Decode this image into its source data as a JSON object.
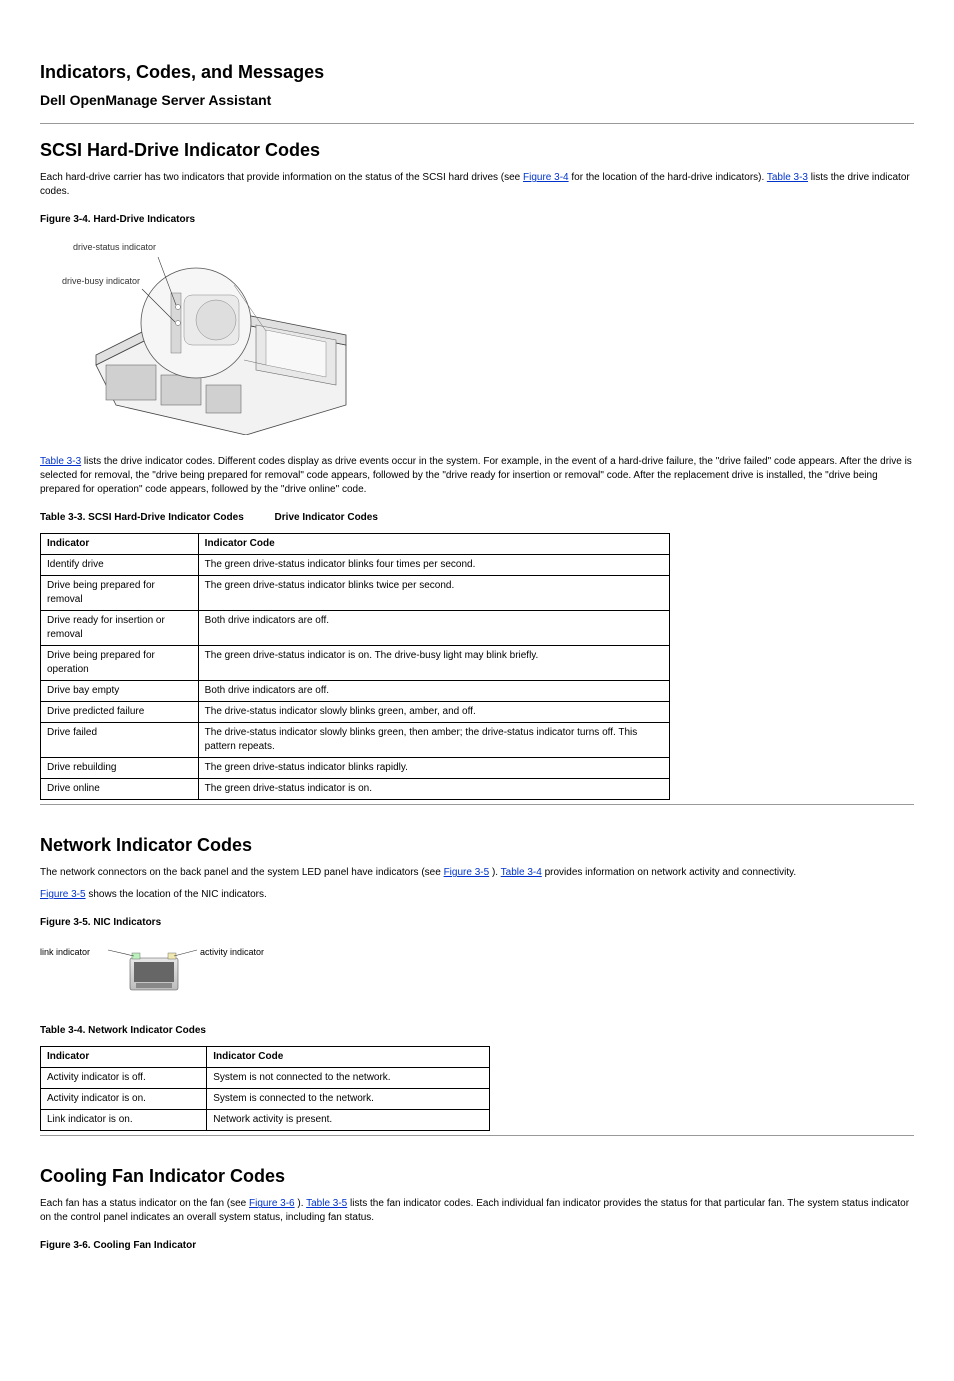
{
  "header": {
    "title": "Indicators, Codes, and Messages",
    "subtitle": "Dell OpenManage Server Assistant"
  },
  "section1": {
    "heading": "SCSI Hard-Drive Indicator Codes",
    "p1a": "Each hard-drive carrier has two indicators that provide information on the status of the SCSI hard drives (see ",
    "fig_link": "Figure 3-4",
    "p1b": " for the location of the hard-drive indicators). ",
    "tbl_link": "Table 3-3",
    "p1c": " lists the drive indicator codes.",
    "fig_caption": "Figure 3-4. Hard-Drive Indicators",
    "callout_status": "drive-status indicator",
    "callout_busy": "drive-busy indicator",
    "p2a": "Table 3-3",
    "p2b": " lists the drive indicator codes. Different codes display as drive events occur in the system. For example, in the event of a hard-drive failure, the \"drive failed\" code appears. After the drive is selected for removal, the \"drive being prepared for removal\" code appears, followed by the \"drive ready for insertion or removal\" code. After the replacement drive is installed, the \"drive being prepared for operation\" code appears, followed by the \"drive online\" code.",
    "table_caption": "Table 3-3. SCSI Hard-Drive Indicator Codes",
    "table_heading": "Drive Indicator Codes",
    "th1": "Indicator",
    "th2": "Indicator Code",
    "rows": [
      {
        "c1": "Identify drive",
        "c2": "The green drive-status indicator blinks four times per second."
      },
      {
        "c1": "Drive being prepared for removal",
        "c2": "The green drive-status indicator blinks twice per second."
      },
      {
        "c1": "Drive ready for insertion or removal",
        "c2": "Both drive indicators are off."
      },
      {
        "c1": "Drive being prepared for operation",
        "c2": "The green drive-status indicator is on. The drive-busy light may blink briefly."
      },
      {
        "c1": "Drive bay empty",
        "c2": "Both drive indicators are off."
      },
      {
        "c1": "Drive predicted failure",
        "c2": "The drive-status indicator slowly blinks green, amber, and off."
      },
      {
        "c1": "Drive failed",
        "c2": "The drive-status indicator slowly blinks green, then amber; the drive-status indicator turns off. This pattern repeats."
      },
      {
        "c1": "Drive rebuilding",
        "c2": "The green drive-status indicator blinks rapidly."
      },
      {
        "c1": "Drive online",
        "c2": "The green drive-status indicator is on."
      }
    ]
  },
  "section2": {
    "heading": "Network Indicator Codes",
    "p1a": "The network connectors on the back panel and the system LED panel have indicators (see ",
    "fig_link": "Figure 3-5",
    "p1b": "). ",
    "tbl_link": "Table 3-4",
    "p1c": " provides information on network activity and connectivity.",
    "fig_caption_a": "Figure 3-5",
    "fig_caption_b": " shows the location of the NIC indicators.",
    "fig_caption2": "Figure 3-5. NIC Indicators",
    "callout_link": "link indicator",
    "callout_activity": "activity indicator",
    "table_caption": "Table 3-4. Network Indicator Codes",
    "th1": "Indicator",
    "th2": "Indicator Code",
    "rows": [
      {
        "c1": "Activity indicator is off.",
        "c2": "System is not connected to the network."
      },
      {
        "c1": "Activity indicator is on.",
        "c2": "System is connected to the network."
      },
      {
        "c1": "Link indicator is on.",
        "c2": "Network activity is present."
      }
    ]
  },
  "section3": {
    "heading": "Cooling Fan Indicator Codes",
    "p1a": "Each fan has a status indicator on the fan (see ",
    "fig_link": "Figure 3-6",
    "p1b": "). ",
    "tbl_link": "Table 3-5",
    "p1c": " lists the fan indicator codes. Each individual fan indicator provides the status for that particular fan. The system status indicator on the control panel indicates an overall system status, including fan status.",
    "fig_caption": "Figure 3-6. Cooling Fan Indicator"
  }
}
